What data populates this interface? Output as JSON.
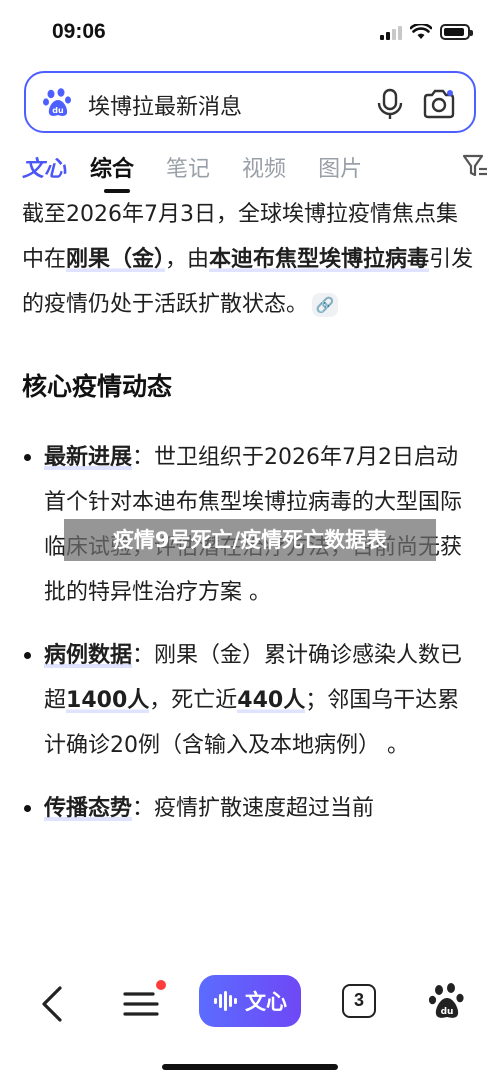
{
  "status_bar": {
    "time": "09:06"
  },
  "search": {
    "query": "埃博拉最新消息",
    "icons": [
      "baidu-paw-icon",
      "microphone-icon",
      "camera-search-icon"
    ]
  },
  "tabs": [
    {
      "label": "文心"
    },
    {
      "label": "综合"
    },
    {
      "label": "笔记"
    },
    {
      "label": "视频"
    },
    {
      "label": "图片"
    }
  ],
  "active_tab": "综合",
  "content": {
    "intro": {
      "t1": "截至2026年7月3日，全球埃博拉疫情焦点集中在",
      "t2": "刚果（金）",
      "t3": "，由",
      "t4": "本迪布焦型埃博拉病毒",
      "t5": "引发的疫情仍处于活跃扩散状态。"
    },
    "section_title": "核心疫情动态",
    "bullets": [
      {
        "key": "最新进展",
        "text": "：世卫组织于2026年7月2日启动首个针对本迪布焦型埃博拉病毒的大型国际临床试验，评估潜在治疗方法，目前尚无获批的特异性治疗方案 。"
      },
      {
        "key": "病例数据",
        "text": "：刚果（金）累计确诊感染人数已超",
        "n1": "1400人",
        "text2": "，死亡近",
        "n2": "440人",
        "text3": "；邻国乌干达累计确诊20例（含输入及本地病例） 。"
      },
      {
        "key": "传播态势",
        "text": "：疫情扩散速度超过当前"
      }
    ]
  },
  "overlay_banner": "疫情9号死亡/疫情死亡数据表",
  "bottom_nav": {
    "wenxin_label": "文心",
    "tab_count": "3"
  },
  "colors": {
    "accent": "#4d5fff",
    "brand_gradient_start": "#5b6cff",
    "brand_gradient_end": "#6f48f5",
    "notification_dot": "#ff3b3b",
    "highlight": "#dfe3ff"
  }
}
